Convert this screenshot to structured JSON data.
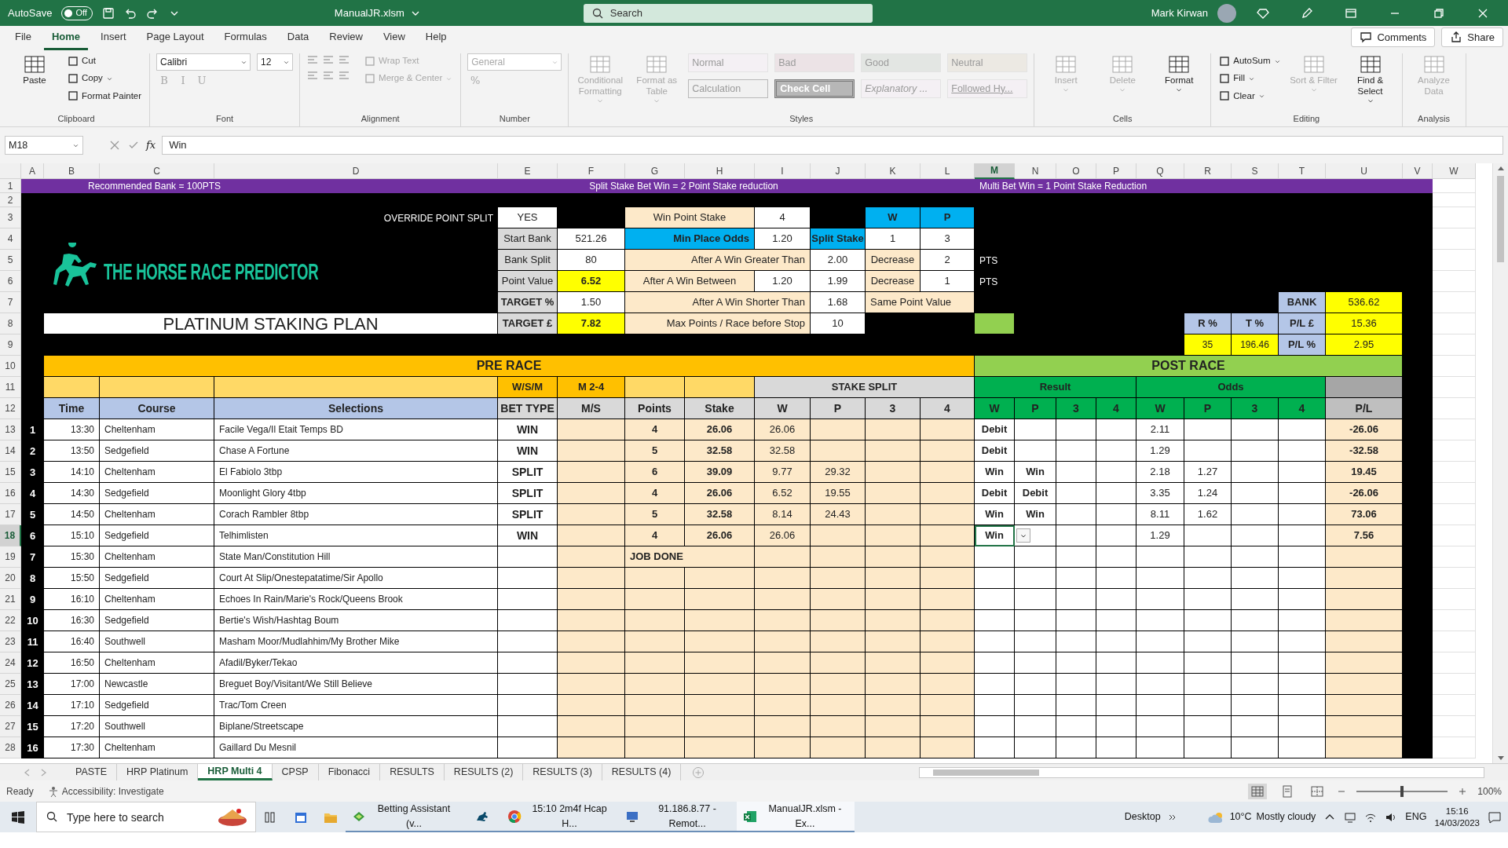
{
  "title_bar": {
    "autosave_label": "AutoSave",
    "autosave": {
      "on": false,
      "label": "Off"
    },
    "filename": "ManualJR.xlsm",
    "search_placeholder": "Search",
    "user": "Mark Kirwan"
  },
  "ribbon_tabs": [
    {
      "label": "File",
      "selected": false
    },
    {
      "label": "Home",
      "selected": true
    },
    {
      "label": "Insert",
      "selected": false
    },
    {
      "label": "Page Layout",
      "selected": false
    },
    {
      "label": "Formulas",
      "selected": false
    },
    {
      "label": "Data",
      "selected": false
    },
    {
      "label": "Review",
      "selected": false
    },
    {
      "label": "View",
      "selected": false
    },
    {
      "label": "Help",
      "selected": false
    }
  ],
  "ribbon_buttons": [
    "Comments",
    "Share"
  ],
  "ribbon": [
    {
      "label": "Clipboard",
      "columns": [
        [
          {
            "kind": "large",
            "label": "Paste",
            "disabled": false,
            "menu": false
          }
        ],
        [
          {
            "kind": "small",
            "label": "Cut",
            "disabled": false,
            "menu": false
          },
          {
            "kind": "small",
            "label": "Copy",
            "disabled": false,
            "menu": true
          },
          {
            "kind": "small",
            "label": "Format Painter",
            "disabled": false,
            "menu": false
          }
        ]
      ]
    },
    {
      "label": "Font",
      "columns": [
        [
          {
            "kind": "combo",
            "value": "Calibri",
            "wide": true,
            "disabled": false
          },
          {
            "kind": "glyphs",
            "glyphs": [
              "B",
              "I",
              "U"
            ],
            "disabled": true
          }
        ],
        [
          {
            "kind": "combo",
            "value": "12",
            "wide": false,
            "disabled": false
          }
        ]
      ]
    },
    {
      "label": "Alignment",
      "columns": [
        [
          {
            "kind": "align",
            "disabled": true
          }
        ],
        [
          {
            "kind": "small",
            "label": "Wrap Text",
            "disabled": true,
            "menu": false
          },
          {
            "kind": "small",
            "label": "Merge & Center",
            "disabled": true,
            "menu": true
          }
        ]
      ]
    },
    {
      "label": "Number",
      "columns": [
        [
          {
            "kind": "combo",
            "value": "General",
            "wide": true,
            "disabled": true
          },
          {
            "kind": "glyphs",
            "glyphs": [
              "%"
            ],
            "disabled": true
          }
        ]
      ]
    },
    {
      "label": "Styles",
      "columns": [
        [
          {
            "kind": "large",
            "label": "Conditional Formatting",
            "disabled": true,
            "menu": true
          }
        ],
        [
          {
            "kind": "large",
            "label": "Format as Table",
            "disabled": true,
            "menu": true
          }
        ],
        [
          {
            "kind": "style",
            "label": "Normal"
          },
          {
            "kind": "style",
            "label": "Calculation"
          }
        ],
        [
          {
            "kind": "style",
            "label": "Bad"
          },
          {
            "kind": "style",
            "label": "Check Cell"
          }
        ],
        [
          {
            "kind": "style",
            "label": "Good"
          },
          {
            "kind": "style",
            "label": "Explanatory ..."
          }
        ],
        [
          {
            "kind": "style",
            "label": "Neutral"
          },
          {
            "kind": "style",
            "label": "Followed Hy..."
          }
        ]
      ]
    },
    {
      "label": "Cells",
      "columns": [
        [
          {
            "kind": "large",
            "label": "Insert",
            "disabled": true,
            "menu": true
          }
        ],
        [
          {
            "kind": "large",
            "label": "Delete",
            "disabled": true,
            "menu": true
          }
        ],
        [
          {
            "kind": "large",
            "label": "Format",
            "disabled": false,
            "menu": true
          }
        ]
      ]
    },
    {
      "label": "Editing",
      "columns": [
        [
          {
            "kind": "small",
            "label": "AutoSum",
            "disabled": false,
            "menu": true
          },
          {
            "kind": "small",
            "label": "Fill",
            "disabled": false,
            "menu": true
          },
          {
            "kind": "small",
            "label": "Clear",
            "disabled": false,
            "menu": true
          }
        ],
        [
          {
            "kind": "large",
            "label": "Sort & Filter",
            "disabled": true,
            "menu": true
          }
        ],
        [
          {
            "kind": "large",
            "label": "Find & Select",
            "disabled": false,
            "menu": true
          }
        ]
      ]
    },
    {
      "label": "Analysis",
      "columns": [
        [
          {
            "kind": "large",
            "label": "Analyze Data",
            "disabled": true,
            "menu": false
          }
        ]
      ]
    }
  ],
  "formula_bar": {
    "name_box": "M18",
    "fx": "fx",
    "formula": "Win"
  },
  "columns": [
    {
      "label": "A",
      "selected": false
    },
    {
      "label": "B",
      "selected": false
    },
    {
      "label": "C",
      "selected": false
    },
    {
      "label": "D",
      "selected": false
    },
    {
      "label": "E",
      "selected": false
    },
    {
      "label": "F",
      "selected": false
    },
    {
      "label": "G",
      "selected": false
    },
    {
      "label": "H",
      "selected": false
    },
    {
      "label": "I",
      "selected": false
    },
    {
      "label": "J",
      "selected": false
    },
    {
      "label": "K",
      "selected": false
    },
    {
      "label": "L",
      "selected": false
    },
    {
      "label": "M",
      "selected": true
    },
    {
      "label": "N",
      "selected": false
    },
    {
      "label": "O",
      "selected": false
    },
    {
      "label": "P",
      "selected": false
    },
    {
      "label": "Q",
      "selected": false
    },
    {
      "label": "R",
      "selected": false
    },
    {
      "label": "S",
      "selected": false
    },
    {
      "label": "T",
      "selected": false
    },
    {
      "label": "U",
      "selected": false
    },
    {
      "label": "V",
      "selected": false
    },
    {
      "label": "W",
      "selected": false
    }
  ],
  "row_headers": [
    {
      "label": "1",
      "selected": false
    },
    {
      "label": "2",
      "selected": false
    },
    {
      "label": "3",
      "selected": false
    },
    {
      "label": "4",
      "selected": false
    },
    {
      "label": "5",
      "selected": false
    },
    {
      "label": "6",
      "selected": false
    },
    {
      "label": "7",
      "selected": false
    },
    {
      "label": "8",
      "selected": false
    },
    {
      "label": "9",
      "selected": false
    },
    {
      "label": "10",
      "selected": false
    },
    {
      "label": "11",
      "selected": false
    },
    {
      "label": "12",
      "selected": false
    },
    {
      "label": "13",
      "selected": false
    },
    {
      "label": "14",
      "selected": false
    },
    {
      "label": "15",
      "selected": false
    },
    {
      "label": "16",
      "selected": false
    },
    {
      "label": "17",
      "selected": false
    },
    {
      "label": "18",
      "selected": true
    },
    {
      "label": "19",
      "selected": false
    },
    {
      "label": "20",
      "selected": false
    },
    {
      "label": "21",
      "selected": false
    },
    {
      "label": "22",
      "selected": false
    },
    {
      "label": "23",
      "selected": false
    },
    {
      "label": "24",
      "selected": false
    },
    {
      "label": "25",
      "selected": false
    },
    {
      "label": "26",
      "selected": false
    },
    {
      "label": "27",
      "selected": false
    },
    {
      "label": "28",
      "selected": false
    }
  ],
  "logo": "THE HORSE RACE PREDICTOR",
  "sheet_rows": [
    {
      "cells": [
        "Recommended Bank = 100PTS",
        "Split Stake Bet Win = 2 Point Stake reduction",
        "Multi Bet Win = 1 Point  Stake Reduction"
      ]
    },
    {
      "cells": [
        "OVERRIDE POINT SPLIT",
        "YES",
        "Win Point Stake",
        "4",
        "W",
        "P"
      ]
    },
    {
      "cells": [
        "Start Bank",
        "521.26",
        "Min Place Odds",
        "1.20",
        "Split Stake",
        "1",
        "3"
      ]
    },
    {
      "cells": [
        "Bank Split",
        "80",
        "After A Win Greater Than",
        "2.00",
        "Decrease",
        "2",
        "PTS"
      ]
    },
    {
      "cells": [
        "Point Value",
        "6.52",
        "After A Win Between",
        "1.20",
        "1.99",
        "Decrease",
        "1",
        "PTS"
      ]
    },
    {
      "cells": [
        "TARGET %",
        "1.50",
        "After A Win Shorter Than",
        "1.68",
        "Same Point Value",
        "BANK",
        "536.62"
      ]
    },
    {
      "cells": [
        "PLATINUM STAKING PLAN",
        "TARGET £",
        "7.82",
        "Max Points / Race before Stop",
        "10",
        "R %",
        "T %",
        "P/L  £",
        "15.36"
      ]
    },
    {
      "cells": [
        "35",
        "196.46",
        "P/L %",
        "2.95"
      ]
    },
    {
      "cells": [
        "PRE RACE",
        "POST RACE"
      ]
    },
    {
      "cells": [
        "W/S/M",
        "M 2-4",
        "STAKE SPLIT",
        "Result",
        "Odds"
      ]
    },
    {
      "cells": [
        "Time",
        "Course",
        "Selections",
        "BET TYPE",
        "M/S",
        "Points",
        "Stake",
        "W",
        "P",
        "3",
        "4",
        "W",
        "P",
        "3",
        "4",
        "W",
        "P",
        "3",
        "4",
        "P/L"
      ]
    }
  ],
  "races": [
    {
      "index": "1",
      "time": "13:30",
      "course": "Cheltenham",
      "selection": "Facile Vega/Il Etait Temps BD",
      "bet_type": "WIN",
      "points": "4",
      "stake": "26.06",
      "w_split": "26.06",
      "result_w": "Debit",
      "odds_w": "2.11",
      "pl": "-26.06",
      "active": false
    },
    {
      "index": "2",
      "time": "13:50",
      "course": "Sedgefield",
      "selection": "Chase A Fortune",
      "bet_type": "WIN",
      "points": "5",
      "stake": "32.58",
      "w_split": "32.58",
      "result_w": "Debit",
      "odds_w": "1.29",
      "pl": "-32.58",
      "active": false
    },
    {
      "index": "3",
      "time": "14:10",
      "course": "Cheltenham",
      "selection": "El Fabiolo 3tbp",
      "bet_type": "SPLIT",
      "points": "6",
      "stake": "39.09",
      "w_split": "9.77",
      "p_split": "29.32",
      "result_w": "Win",
      "result_p": "Win",
      "odds_w": "2.18",
      "odds_p": "1.27",
      "pl": "19.45",
      "active": false
    },
    {
      "index": "4",
      "time": "14:30",
      "course": "Sedgefield",
      "selection": "Moonlight Glory 4tbp",
      "bet_type": "SPLIT",
      "points": "4",
      "stake": "26.06",
      "w_split": "6.52",
      "p_split": "19.55",
      "result_w": "Debit",
      "result_p": "Debit",
      "odds_w": "3.35",
      "odds_p": "1.24",
      "pl": "-26.06",
      "active": false
    },
    {
      "index": "5",
      "time": "14:50",
      "course": "Cheltenham",
      "selection": "Corach Rambler 8tbp",
      "bet_type": "SPLIT",
      "points": "5",
      "stake": "32.58",
      "w_split": "8.14",
      "p_split": "24.43",
      "result_w": "Win",
      "result_p": "Win",
      "odds_w": "8.11",
      "odds_p": "1.62",
      "pl": "73.06",
      "active": false
    },
    {
      "index": "6",
      "time": "15:10",
      "course": "Sedgefield",
      "selection": "Telhimlisten",
      "bet_type": "WIN",
      "points": "4",
      "stake": "26.06",
      "w_split": "26.06",
      "result_w": "Win",
      "odds_w": "1.29",
      "pl": "7.56",
      "active": true
    },
    {
      "index": "7",
      "time": "15:30",
      "course": "Cheltenham",
      "selection": "State Man/Constitution Hill",
      "note": "JOB DONE",
      "active": false
    },
    {
      "index": "8",
      "time": "15:50",
      "course": "Sedgefield",
      "selection": "Court At Slip/Onestepatatime/Sir Apollo",
      "active": false
    },
    {
      "index": "9",
      "time": "16:10",
      "course": "Cheltenham",
      "selection": "Echoes In Rain/Marie's Rock/Queens Brook",
      "active": false
    },
    {
      "index": "10",
      "time": "16:30",
      "course": "Sedgefield",
      "selection": "Bertie's Wish/Hashtag Boum",
      "active": false
    },
    {
      "index": "11",
      "time": "16:40",
      "course": "Southwell",
      "selection": "Masham Moor/Mudlahhim/My Brother Mike",
      "active": false
    },
    {
      "index": "12",
      "time": "16:50",
      "course": "Cheltenham",
      "selection": "Afadil/Byker/Tekao",
      "active": false
    },
    {
      "index": "13",
      "time": "17:00",
      "course": "Newcastle",
      "selection": "Breguet Boy/Visitant/We Still Believe",
      "active": false
    },
    {
      "index": "14",
      "time": "17:10",
      "course": "Sedgefield",
      "selection": "Trac/Tom Creen",
      "active": false
    },
    {
      "index": "15",
      "time": "17:20",
      "course": "Southwell",
      "selection": "Biplane/Streetscape",
      "active": false
    },
    {
      "index": "16",
      "time": "17:30",
      "course": "Cheltenham",
      "selection": "Gaillard Du Mesnil",
      "active": false
    }
  ],
  "sheet_tabs": [
    {
      "label": "PASTE",
      "selected": false
    },
    {
      "label": "HRP Platinum",
      "selected": false
    },
    {
      "label": "HRP Multi 4",
      "selected": true
    },
    {
      "label": "CPSP",
      "selected": false
    },
    {
      "label": "Fibonacci",
      "selected": false
    },
    {
      "label": "RESULTS",
      "selected": false
    },
    {
      "label": "RESULTS (2)",
      "selected": false
    },
    {
      "label": "RESULTS (3)",
      "selected": false
    },
    {
      "label": "RESULTS (4)",
      "selected": false
    }
  ],
  "status_bar": {
    "status": "Ready",
    "accessibility": "Accessibility: Investigate",
    "views": [
      {
        "selected": true
      },
      {
        "selected": false
      },
      {
        "selected": false
      }
    ],
    "zoom": {
      "level": 0.5,
      "reading": "100%"
    }
  },
  "taskbar": {
    "search_placeholder": "Type here to search",
    "apps": [
      {
        "kind": "betting",
        "label": "Betting Assistant (v...",
        "active": false
      },
      {
        "kind": "horse",
        "active": false
      },
      {
        "kind": "browser",
        "label": "15:10 2m4f Hcap H...",
        "active": false
      },
      {
        "kind": "remote",
        "label": "91.186.8.77 - Remot...",
        "active": false
      },
      {
        "kind": "excel",
        "label": "ManualJR.xlsm - Ex...",
        "active": true
      }
    ],
    "desktop": "Desktop",
    "weather": {
      "temp": "10°C",
      "text": "Mostly cloudy"
    },
    "lang": "ENG",
    "time": "15:16",
    "date": "14/03/2023"
  }
}
